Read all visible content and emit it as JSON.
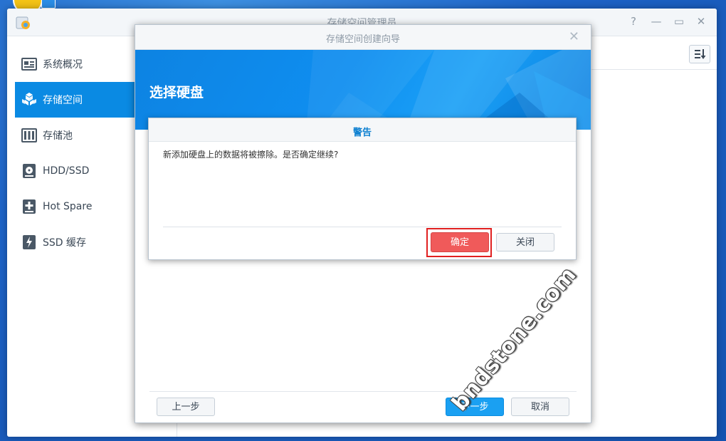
{
  "window": {
    "title": "存储空间管理员"
  },
  "window_controls": {
    "help": "?",
    "minimize": "—",
    "maximize": "▭",
    "close": "✕"
  },
  "sidebar": {
    "items": [
      {
        "label": "系统概况",
        "icon": "overview-icon",
        "active": false
      },
      {
        "label": "存储空间",
        "icon": "storage-space-icon",
        "active": true
      },
      {
        "label": "存储池",
        "icon": "storage-pool-icon",
        "active": false
      },
      {
        "label": "HDD/SSD",
        "icon": "hdd-icon",
        "active": false
      },
      {
        "label": "Hot Spare",
        "icon": "hot-spare-icon",
        "active": false
      },
      {
        "label": "SSD 缓存",
        "icon": "ssd-cache-icon",
        "active": false
      }
    ]
  },
  "wizard": {
    "title": "存储空间创建向导",
    "close": "✕",
    "step_title": "选择硬盘",
    "buttons": {
      "prev": "上一步",
      "next": "下一步",
      "cancel": "取消"
    }
  },
  "warning": {
    "title": "警告",
    "message": "新添加硬盘上的数据将被擦除。是否确定继续?",
    "confirm": "确定",
    "close": "关闭"
  },
  "watermark": "bndstone.com",
  "colors": {
    "accent": "#0a8ae3",
    "confirm": "#f05a5a",
    "highlight": "#e02020",
    "banner": "#0f8ef0"
  }
}
